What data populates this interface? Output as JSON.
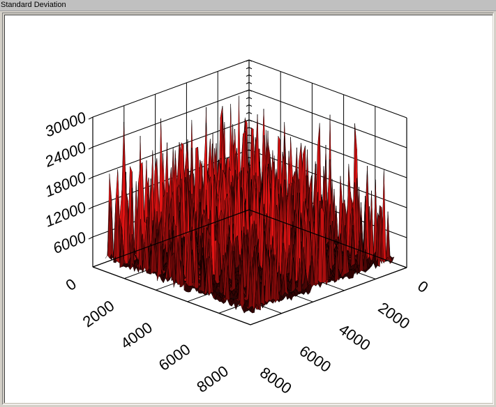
{
  "window": {
    "title": "Standard Deviation"
  },
  "colors": {
    "surface_dark": "#1a0000",
    "surface_mid": "#4a0a0a",
    "surface_bright": "#c81010",
    "spike_highlight": "#ff2020",
    "axis": "#000000",
    "background": "#ffffff"
  },
  "chart_data": {
    "type": "surface",
    "z_axis": {
      "ticks": [
        "6000",
        "12000",
        "18000",
        "24000",
        "30000"
      ]
    },
    "x_axis_left": {
      "ticks": [
        "0",
        "2000",
        "4000",
        "6000",
        "8000"
      ]
    },
    "x_axis_right": {
      "ticks": [
        "0",
        "2000",
        "4000",
        "6000",
        "8000"
      ]
    },
    "z_range": [
      0,
      30000
    ],
    "grid": true
  }
}
